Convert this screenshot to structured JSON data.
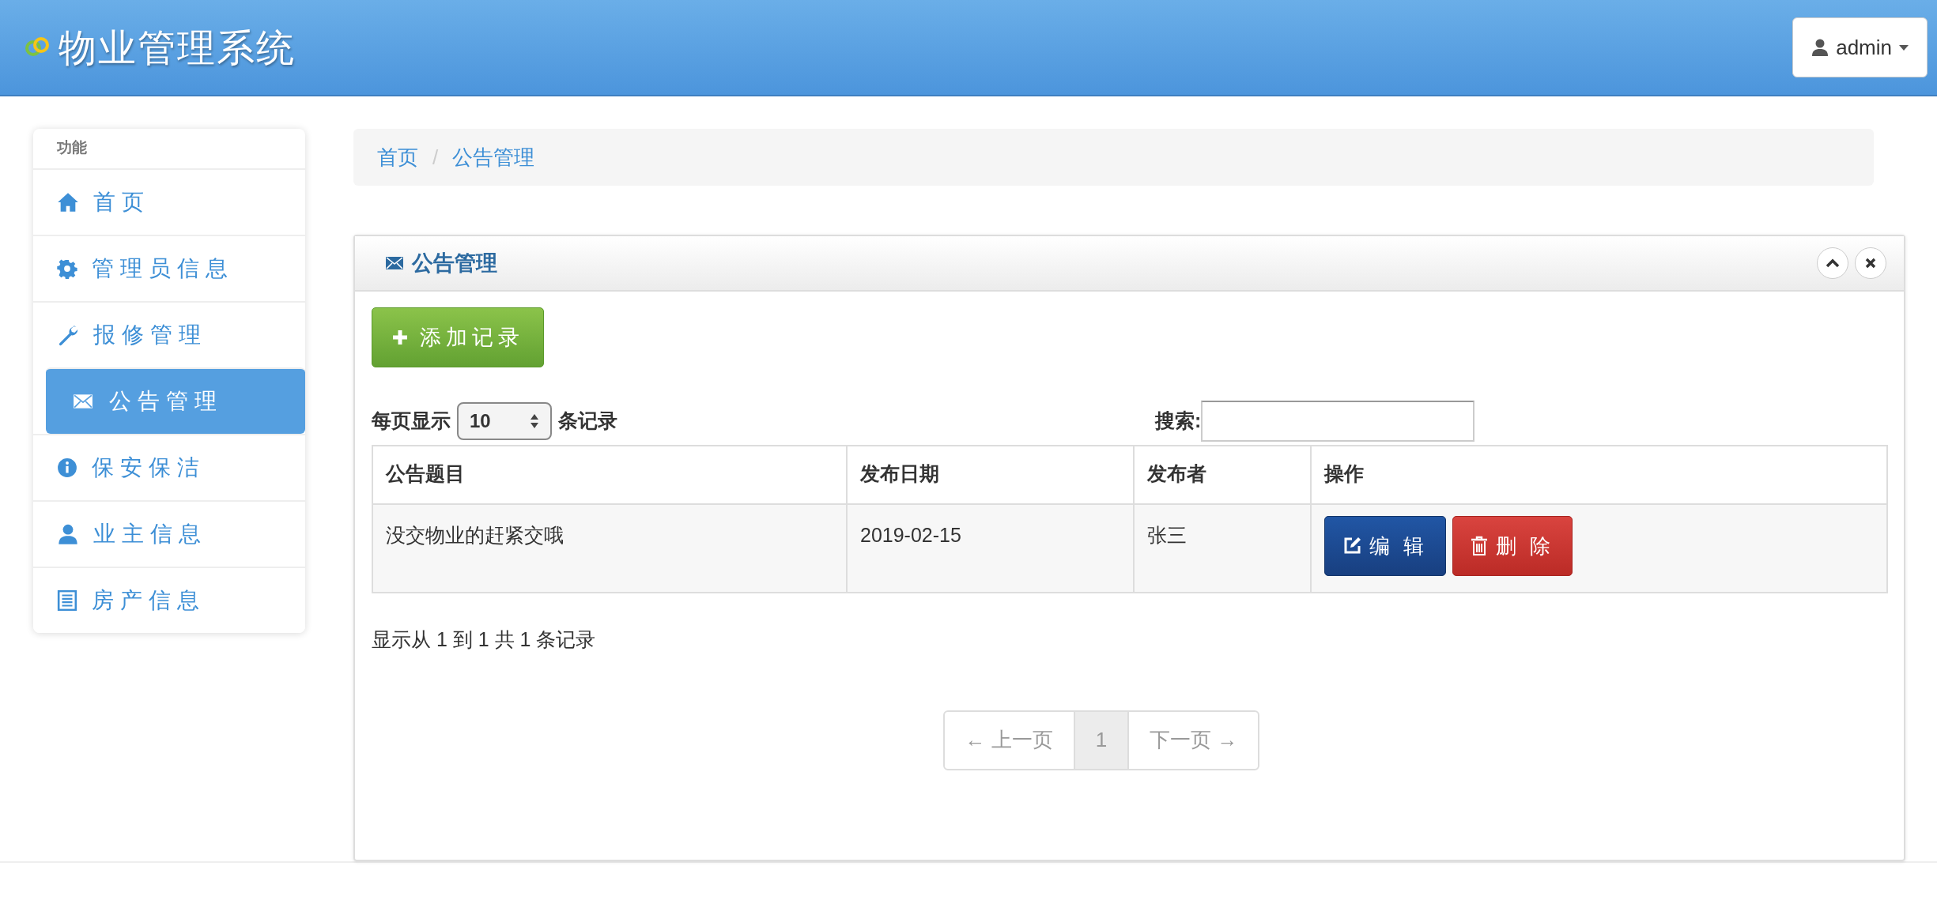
{
  "header": {
    "title": "物业管理系统",
    "user_button": "admin"
  },
  "sidebar": {
    "heading": "功能",
    "items": [
      {
        "label": "首页",
        "selected": false
      },
      {
        "label": "管理员信息",
        "selected": false
      },
      {
        "label": "报修管理",
        "selected": false
      },
      {
        "label": "公告管理",
        "selected": true
      },
      {
        "label": "保安保洁",
        "selected": false
      },
      {
        "label": "业主信息",
        "selected": false
      },
      {
        "label": "房产信息",
        "selected": false
      }
    ]
  },
  "breadcrumb": {
    "separator": "/",
    "items": [
      "首页",
      "公告管理"
    ]
  },
  "panel": {
    "title": "公告管理",
    "add_button": "添加记录",
    "page_size": {
      "before": "每页显示",
      "value": "10",
      "after": "条记录"
    },
    "search": {
      "label": "搜索:"
    },
    "table": {
      "columns": [
        "公告题目",
        "发布日期",
        "发布者",
        "操作"
      ],
      "rows": [
        {
          "cells": [
            "没交物业的赶紧交哦",
            "2019-02-15",
            "张三"
          ],
          "actions": [
            "编 辑",
            "删 除"
          ]
        }
      ]
    },
    "info": "显示从 1 到 1 共 1 条记录",
    "pagination": [
      {
        "label": "← 上一页",
        "disabled": true,
        "selected": false
      },
      {
        "label": "1",
        "disabled": false,
        "selected": true
      },
      {
        "label": "下一页 →",
        "disabled": true,
        "selected": false
      }
    ]
  }
}
